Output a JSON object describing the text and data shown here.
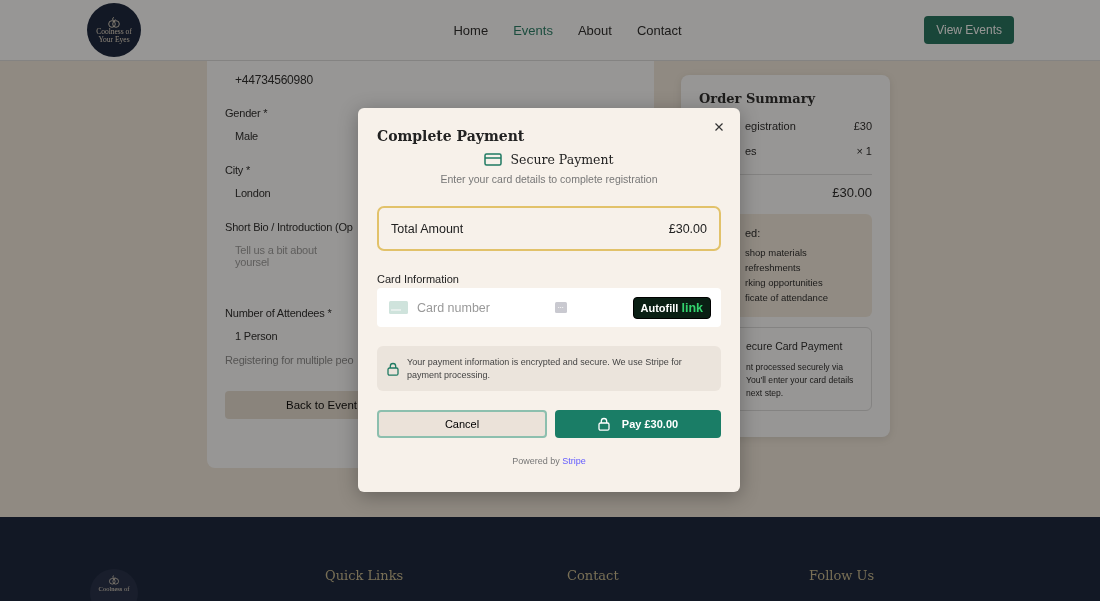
{
  "header": {
    "logo": {
      "line1": "Coolness of",
      "line2": "Your Eyes"
    },
    "nav": [
      {
        "label": "Home",
        "selected": false
      },
      {
        "label": "Events",
        "selected": true
      },
      {
        "label": "About",
        "selected": false
      },
      {
        "label": "Contact",
        "selected": false
      }
    ],
    "cta": "View Events"
  },
  "form": {
    "phone_value": "+44734560980",
    "fields": [
      {
        "kind": "value",
        "label": "Gender *",
        "text": "Male"
      },
      {
        "kind": "value",
        "label": "City *",
        "text": "London"
      },
      {
        "kind": "textarea",
        "label": "Short Bio / Introduction (Op",
        "text": "Tell us a bit about yoursel"
      },
      {
        "kind": "value",
        "label": "Number of Attendees *",
        "text": "1 Person"
      }
    ],
    "hint": "Registering for multiple peo",
    "back_button": "Back to Event"
  },
  "summary": {
    "title": "Order Summary",
    "rows": [
      {
        "label": "egistration",
        "value": "£30"
      },
      {
        "label": "es",
        "value": "× 1"
      }
    ],
    "total": "£30.00",
    "included": {
      "title": "ed:",
      "items": [
        "shop materials",
        "refreshments",
        "rking opportunities",
        "ficate of attendance"
      ]
    },
    "secure": {
      "title": "ecure Card Payment",
      "lines": [
        "nt processed securely via",
        "You'll enter your card details",
        "next step."
      ]
    }
  },
  "modal": {
    "title": "Complete Payment",
    "subtitle": "Secure Payment",
    "description": "Enter your card details to complete registration",
    "total": {
      "label": "Total Amount",
      "amount": "£30.00"
    },
    "card_label": "Card Information",
    "card_placeholder": "Card number",
    "autofill": {
      "label": "Autofill",
      "brand": "link"
    },
    "notice": "Your payment information is encrypted and secure. We use Stripe for payment processing.",
    "cancel": "Cancel",
    "pay": "Pay £30.00",
    "powered": {
      "prefix": "Powered by",
      "brand": "Stripe"
    }
  },
  "footer": {
    "logo": "Coolness of",
    "headings": [
      "Quick Links",
      "Contact",
      "Follow Us"
    ]
  }
}
